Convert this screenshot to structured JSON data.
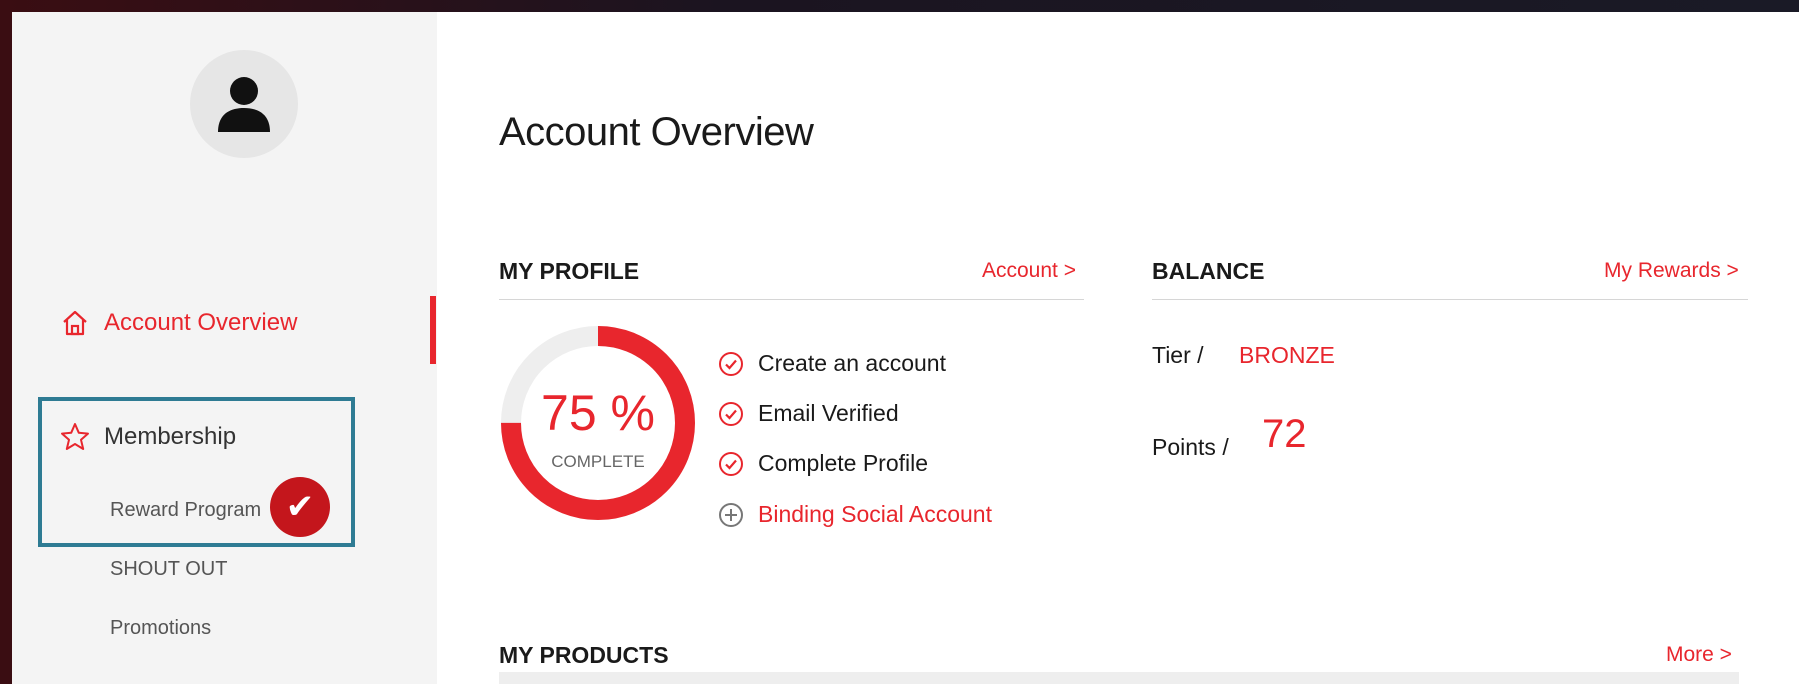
{
  "sidebar": {
    "nav_overview_label": "Account Overview",
    "nav_membership_label": "Membership",
    "sub_items": [
      "Reward Program",
      "SHOUT OUT",
      "Promotions"
    ],
    "check_glyph": "✔"
  },
  "main": {
    "title": "Account Overview",
    "profile": {
      "heading": "MY PROFILE",
      "link": "Account >",
      "percent_text": "75 %",
      "percent_value": 75,
      "complete_label": "COMPLETE",
      "steps": [
        {
          "label": "Create an account",
          "status": "done"
        },
        {
          "label": "Email Verified",
          "status": "done"
        },
        {
          "label": "Complete Profile",
          "status": "done"
        },
        {
          "label": "Binding Social Account",
          "status": "todo"
        }
      ]
    },
    "balance": {
      "heading": "BALANCE",
      "link": "My Rewards >",
      "tier_label": "Tier /",
      "tier_value": "BRONZE",
      "points_label": "Points /",
      "points_value": "72"
    },
    "products": {
      "heading": "MY PRODUCTS",
      "link": "More >"
    }
  },
  "colors": {
    "accent": "#e8262d",
    "highlight_border": "#2e7b93",
    "badge": "#c4161c"
  },
  "icons": [
    "user-icon",
    "home-icon",
    "star-icon",
    "check-circle-icon",
    "plus-circle-icon",
    "checkmark-icon"
  ]
}
